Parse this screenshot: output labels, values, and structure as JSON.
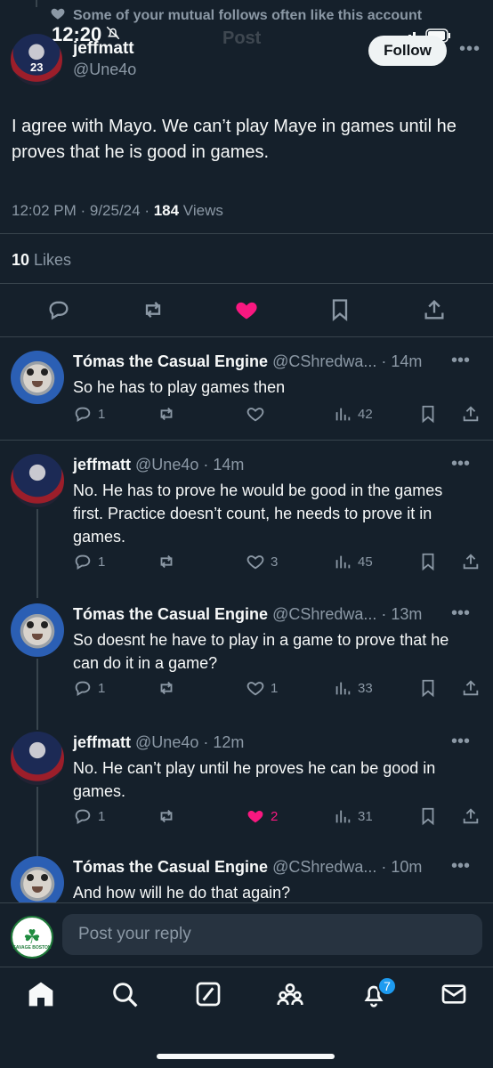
{
  "context": {
    "text": "Some of your mutual follows often like this account"
  },
  "status_bar": {
    "time": "12:20",
    "header_title_faded": "Post"
  },
  "main_post": {
    "author_name": "jeffmatt",
    "author_handle": "@Une4o",
    "jersey_number": "23",
    "follow_label": "Follow",
    "text": "I agree with Mayo.  We can’t play Maye in games until he proves that he is good in games.",
    "time_date": "12:02 PM · 9/25/24 · ",
    "views_count": "184",
    "views_label": " Views",
    "likes_count": "10",
    "likes_label": " Likes",
    "liked": true,
    "accent_like_color": "#f91880"
  },
  "replies": [
    {
      "name": "Tómas the Casual Engine",
      "handle": "@CShredwa... · 14m",
      "text": "So he has to play games then",
      "replies": "1",
      "retweets": "",
      "likes": "",
      "views": "42",
      "liked": false,
      "avatar": "thomas"
    },
    {
      "name": "jeffmatt",
      "handle": "@Une4o · 14m",
      "text": "No.  He has to prove he would be good in the games first.  Practice doesn’t count, he needs to prove it in games.",
      "replies": "1",
      "retweets": "",
      "likes": "3",
      "views": "45",
      "liked": false,
      "avatar": "jeff"
    },
    {
      "name": "Tómas the Casual Engine",
      "handle": "@CShredwa... · 13m",
      "text": "So doesnt he have to play in a game to prove that he can do it in a game?",
      "replies": "1",
      "retweets": "",
      "likes": "1",
      "views": "33",
      "liked": false,
      "avatar": "thomas"
    },
    {
      "name": "jeffmatt",
      "handle": "@Une4o · 12m",
      "text": "No.  He can’t play until he proves he can be good in games.",
      "replies": "1",
      "retweets": "",
      "likes": "2",
      "views": "31",
      "liked": true,
      "avatar": "jeff"
    },
    {
      "name": "Tómas the Casual Engine",
      "handle": "@CShredwa... · 10m",
      "text": "And how will he do that again?",
      "replies": "",
      "retweets": "",
      "likes": "",
      "views": "",
      "liked": false,
      "avatar": "thomas"
    }
  ],
  "compose": {
    "placeholder": "Post your reply",
    "avatar_text": "SAVAGE BOSTON"
  },
  "tabbar": {
    "notifications_badge": "7",
    "tabs": [
      "home-icon",
      "search-icon",
      "grok-icon",
      "communities-icon",
      "notifications-icon",
      "messages-icon"
    ]
  }
}
